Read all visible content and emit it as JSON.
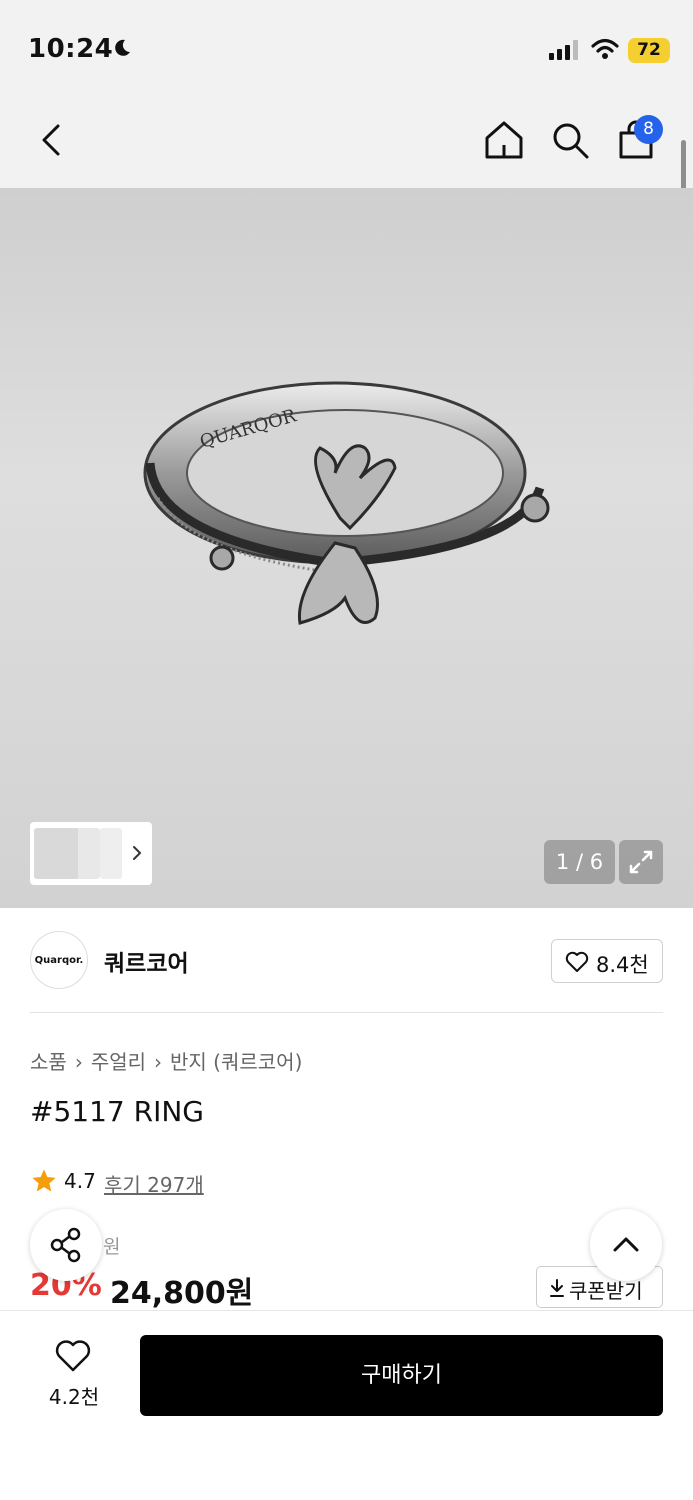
{
  "status_bar": {
    "time": "10:24",
    "battery": "72"
  },
  "header": {
    "cart_count": "8"
  },
  "gallery": {
    "counter": "1 / 6"
  },
  "brand": {
    "logo_text": "Quarqor.",
    "name": "쿼르코어",
    "likes": "8.4천"
  },
  "breadcrumb": [
    "소품",
    "주얼리",
    "반지 (쿼르코어)"
  ],
  "product": {
    "engraving": "QUARQOR",
    "title": "#5117 RING",
    "rating": "4.7",
    "reviews": "후기 297개",
    "original_price": "원",
    "discount": "20%",
    "price": "24,800원"
  },
  "coupon": {
    "label": "쿠폰받기"
  },
  "bottom_bar": {
    "wish_count": "4.2천",
    "buy_label": "구매하기"
  },
  "colors": {
    "accent_red": "#e53935",
    "badge_blue": "#2563eb",
    "battery_yellow": "#f5cf2f"
  }
}
